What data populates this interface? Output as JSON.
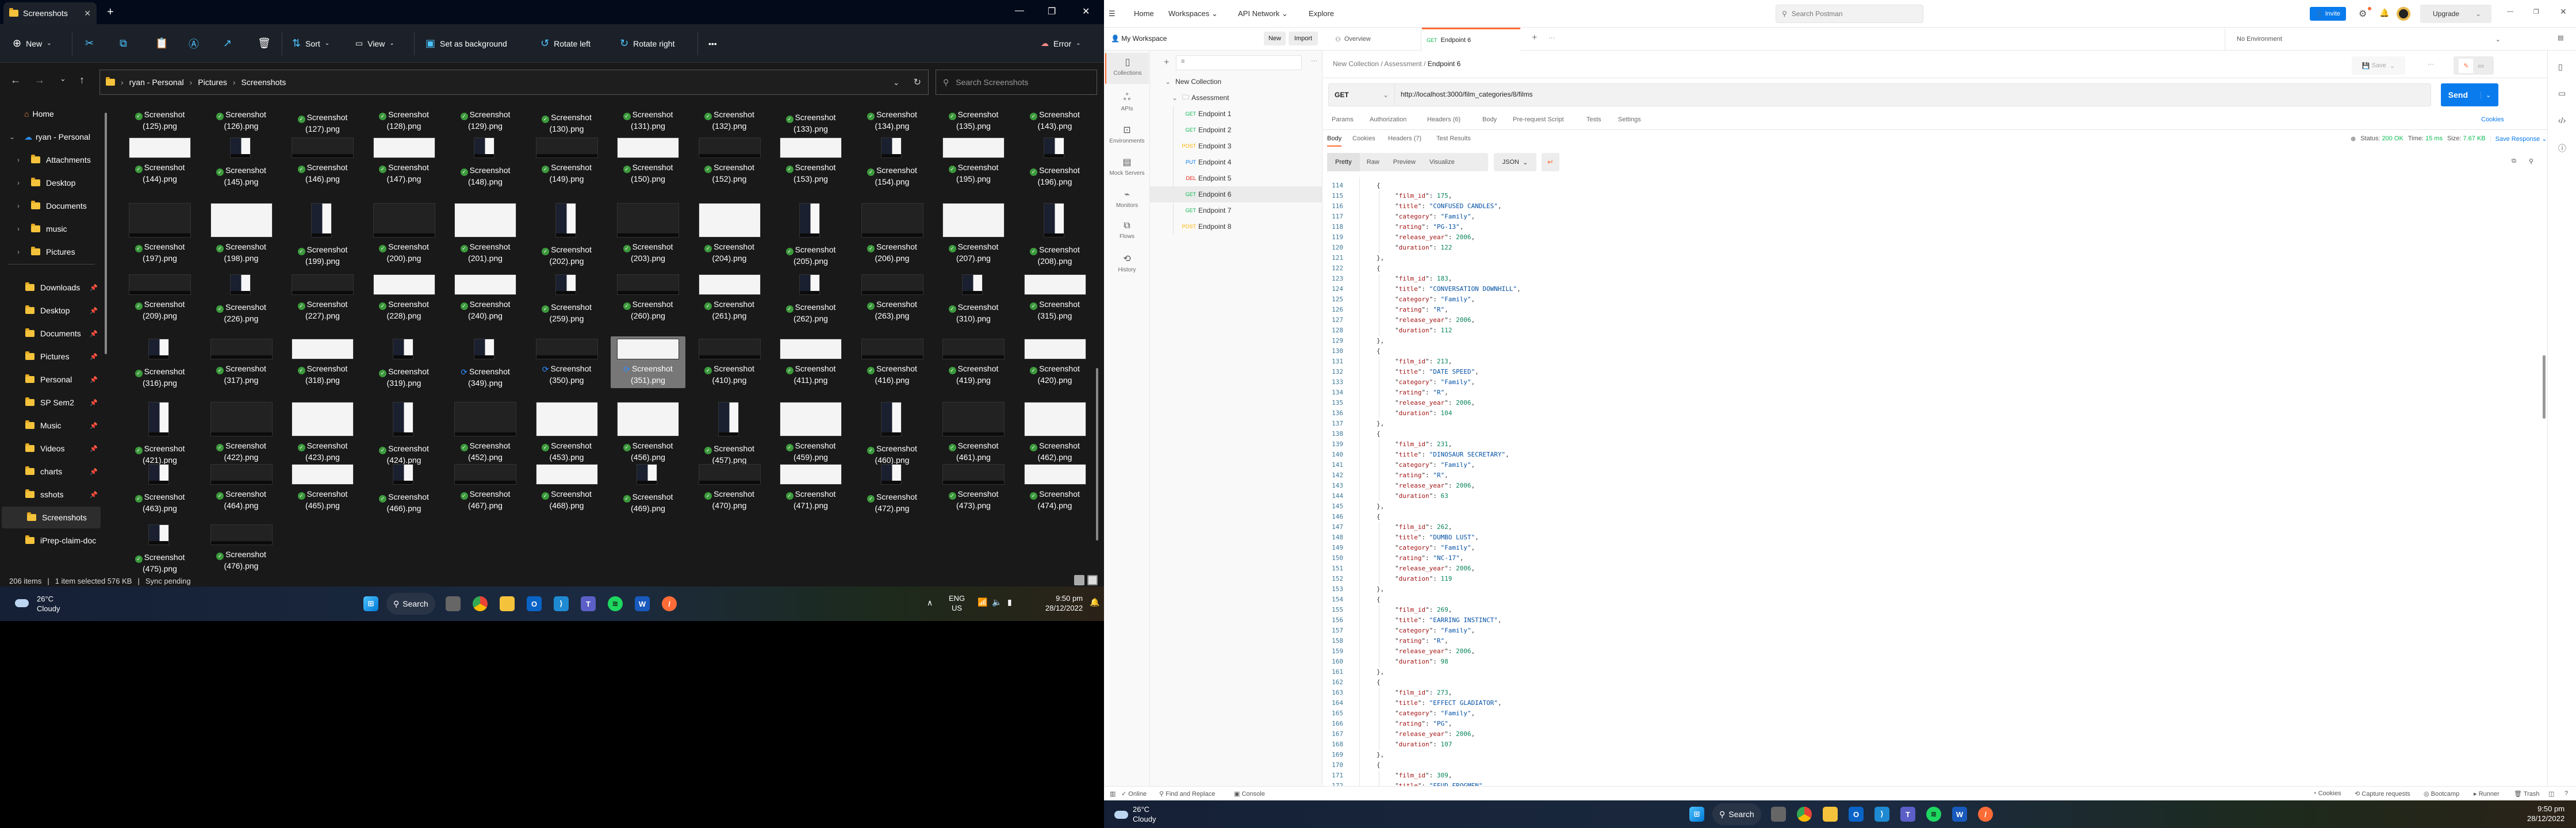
{
  "explorer": {
    "tab_title": "Screenshots",
    "new_tab": "+",
    "toolbar": {
      "new": "New",
      "sort": "Sort",
      "view": "View",
      "set_background": "Set as background",
      "rotate_left": "Rotate left",
      "rotate_right": "Rotate right",
      "more": "•••",
      "onedrive_status": "Error"
    },
    "breadcrumb": [
      "ryan - Personal",
      "Pictures",
      "Screenshots"
    ],
    "search_placeholder": "Search Screenshots",
    "sidebar": {
      "home": "Home",
      "onedrive": "ryan - Personal",
      "onedrive_children": [
        "Attachments",
        "Desktop",
        "Documents",
        "music",
        "Pictures"
      ],
      "quick_access": [
        "Downloads",
        "Desktop",
        "Documents",
        "Pictures",
        "Personal",
        "SP Sem2",
        "Music",
        "Videos",
        "charts",
        "sshots",
        "Screenshots",
        "iPrep-claim-doc"
      ]
    },
    "files": {
      "label_prefix": "Screenshot",
      "rows": [
        [
          "125",
          "126",
          "127",
          "128",
          "129",
          "130",
          "131",
          "132",
          "133",
          "134",
          "135",
          "143"
        ],
        [
          "144",
          "145",
          "146",
          "147",
          "148",
          "149",
          "150",
          "152",
          "153",
          "154",
          "195",
          "196"
        ],
        [
          "197",
          "198",
          "199",
          "200",
          "201",
          "202",
          "203",
          "204",
          "205",
          "206",
          "207",
          "208"
        ],
        [
          "209",
          "226",
          "227",
          "228",
          "240",
          "259",
          "260",
          "261",
          "262",
          "263",
          "310",
          "315"
        ],
        [
          "316",
          "317",
          "318",
          "319",
          "349",
          "350",
          "351",
          "410",
          "411",
          "416",
          "419",
          "420"
        ],
        [
          "421",
          "422",
          "423",
          "424",
          "452",
          "453",
          "456",
          "457",
          "459",
          "460",
          "461",
          "462"
        ],
        [
          "463",
          "464",
          "465",
          "466",
          "467",
          "468",
          "469",
          "470",
          "471",
          "472",
          "473",
          "474"
        ],
        [
          "475",
          "476"
        ]
      ],
      "pending_sync": [
        "349",
        "350",
        "351"
      ],
      "selected": "351"
    },
    "status": {
      "items": "206 items",
      "selected": "1 item selected  576 KB",
      "sync": "Sync pending"
    }
  },
  "taskbar": {
    "weather_temp": "26°C",
    "weather_desc": "Cloudy",
    "search": "Search",
    "lang": "ENG",
    "region": "US",
    "time": "9:50 pm",
    "date": "28/12/2022"
  },
  "postman": {
    "nav": [
      "Home",
      "Workspaces",
      "API Network",
      "Explore"
    ],
    "search_placeholder": "Search Postman",
    "invite": "Invite",
    "upgrade": "Upgrade",
    "workspace": "My Workspace",
    "new": "New",
    "import": "Import",
    "tabs": [
      {
        "label": "Overview"
      },
      {
        "method": "GET",
        "label": "Endpoint 6"
      }
    ],
    "environment": "No Environment",
    "rail": [
      "Collections",
      "APIs",
      "Environments",
      "Mock Servers",
      "Monitors",
      "Flows",
      "History"
    ],
    "collection": "New Collection",
    "folder": "Assessment",
    "endpoints": [
      {
        "method": "GET",
        "name": "Endpoint 1"
      },
      {
        "method": "GET",
        "name": "Endpoint 2"
      },
      {
        "method": "POST",
        "name": "Endpoint 3"
      },
      {
        "method": "PUT",
        "name": "Endpoint 4"
      },
      {
        "method": "DEL",
        "name": "Endpoint 5"
      },
      {
        "method": "GET",
        "name": "Endpoint 6"
      },
      {
        "method": "GET",
        "name": "Endpoint 7"
      },
      {
        "method": "POST",
        "name": "Endpoint 8"
      }
    ],
    "method_colors": {
      "GET": "#0cbb52",
      "POST": "#ffb400",
      "PUT": "#097bed",
      "DEL": "#eb2013"
    },
    "breadcrumb": [
      "New Collection",
      "Assessment",
      "Endpoint 6"
    ],
    "save": "Save",
    "request": {
      "method": "GET",
      "url": "http://localhost:3000/film_categories/8/films",
      "send": "Send"
    },
    "request_tabs": [
      "Params",
      "Authorization",
      "Headers (6)",
      "Body",
      "Pre-request Script",
      "Tests",
      "Settings"
    ],
    "cookies_link": "Cookies",
    "response_tabs": [
      "Body",
      "Cookies",
      "Headers (7)",
      "Test Results"
    ],
    "response_status": {
      "status": "Status: 200 OK",
      "time": "Time: 15 ms",
      "size": "Size: 7.67 KB",
      "save": "Save Response"
    },
    "view_modes": [
      "Pretty",
      "Raw",
      "Preview",
      "Visualize"
    ],
    "format": "JSON",
    "code_lines": [
      {
        "n": 114,
        "b": "{"
      },
      {
        "n": 115,
        "k": "film_id",
        "v": "175",
        "t": "num"
      },
      {
        "n": 116,
        "k": "title",
        "v": "CONFUSED CANDLES",
        "t": "str"
      },
      {
        "n": 117,
        "k": "category",
        "v": "Family",
        "t": "str"
      },
      {
        "n": 118,
        "k": "rating",
        "v": "PG-13",
        "t": "str"
      },
      {
        "n": 119,
        "k": "release_year",
        "v": "2006",
        "t": "num"
      },
      {
        "n": 120,
        "k": "duration",
        "v": "122",
        "t": "num",
        "last": true
      },
      {
        "n": 121,
        "b": "},"
      },
      {
        "n": 122,
        "b": "{"
      },
      {
        "n": 123,
        "k": "film_id",
        "v": "183",
        "t": "num"
      },
      {
        "n": 124,
        "k": "title",
        "v": "CONVERSATION DOWNHILL",
        "t": "str"
      },
      {
        "n": 125,
        "k": "category",
        "v": "Family",
        "t": "str"
      },
      {
        "n": 126,
        "k": "rating",
        "v": "R",
        "t": "str"
      },
      {
        "n": 127,
        "k": "release_year",
        "v": "2006",
        "t": "num"
      },
      {
        "n": 128,
        "k": "duration",
        "v": "112",
        "t": "num",
        "last": true
      },
      {
        "n": 129,
        "b": "},"
      },
      {
        "n": 130,
        "b": "{"
      },
      {
        "n": 131,
        "k": "film_id",
        "v": "213",
        "t": "num"
      },
      {
        "n": 132,
        "k": "title",
        "v": "DATE SPEED",
        "t": "str"
      },
      {
        "n": 133,
        "k": "category",
        "v": "Family",
        "t": "str"
      },
      {
        "n": 134,
        "k": "rating",
        "v": "R",
        "t": "str"
      },
      {
        "n": 135,
        "k": "release_year",
        "v": "2006",
        "t": "num"
      },
      {
        "n": 136,
        "k": "duration",
        "v": "104",
        "t": "num",
        "last": true
      },
      {
        "n": 137,
        "b": "},"
      },
      {
        "n": 138,
        "b": "{"
      },
      {
        "n": 139,
        "k": "film_id",
        "v": "231",
        "t": "num"
      },
      {
        "n": 140,
        "k": "title",
        "v": "DINOSAUR SECRETARY",
        "t": "str"
      },
      {
        "n": 141,
        "k": "category",
        "v": "Family",
        "t": "str"
      },
      {
        "n": 142,
        "k": "rating",
        "v": "R",
        "t": "str"
      },
      {
        "n": 143,
        "k": "release_year",
        "v": "2006",
        "t": "num"
      },
      {
        "n": 144,
        "k": "duration",
        "v": "63",
        "t": "num",
        "last": true
      },
      {
        "n": 145,
        "b": "},"
      },
      {
        "n": 146,
        "b": "{"
      },
      {
        "n": 147,
        "k": "film_id",
        "v": "262",
        "t": "num"
      },
      {
        "n": 148,
        "k": "title",
        "v": "DUMBO LUST",
        "t": "str"
      },
      {
        "n": 149,
        "k": "category",
        "v": "Family",
        "t": "str"
      },
      {
        "n": 150,
        "k": "rating",
        "v": "NC-17",
        "t": "str"
      },
      {
        "n": 151,
        "k": "release_year",
        "v": "2006",
        "t": "num"
      },
      {
        "n": 152,
        "k": "duration",
        "v": "119",
        "t": "num",
        "last": true
      },
      {
        "n": 153,
        "b": "},"
      },
      {
        "n": 154,
        "b": "{"
      },
      {
        "n": 155,
        "k": "film_id",
        "v": "269",
        "t": "num"
      },
      {
        "n": 156,
        "k": "title",
        "v": "EARRING INSTINCT",
        "t": "str"
      },
      {
        "n": 157,
        "k": "category",
        "v": "Family",
        "t": "str"
      },
      {
        "n": 158,
        "k": "rating",
        "v": "R",
        "t": "str"
      },
      {
        "n": 159,
        "k": "release_year",
        "v": "2006",
        "t": "num"
      },
      {
        "n": 160,
        "k": "duration",
        "v": "98",
        "t": "num",
        "last": true
      },
      {
        "n": 161,
        "b": "},"
      },
      {
        "n": 162,
        "b": "{"
      },
      {
        "n": 163,
        "k": "film_id",
        "v": "273",
        "t": "num"
      },
      {
        "n": 164,
        "k": "title",
        "v": "EFFECT GLADIATOR",
        "t": "str"
      },
      {
        "n": 165,
        "k": "category",
        "v": "Family",
        "t": "str"
      },
      {
        "n": 166,
        "k": "rating",
        "v": "PG",
        "t": "str"
      },
      {
        "n": 167,
        "k": "release_year",
        "v": "2006",
        "t": "num"
      },
      {
        "n": 168,
        "k": "duration",
        "v": "107",
        "t": "num",
        "last": true
      },
      {
        "n": 169,
        "b": "},"
      },
      {
        "n": 170,
        "b": "{"
      },
      {
        "n": 171,
        "k": "film_id",
        "v": "309",
        "t": "num"
      },
      {
        "n": 172,
        "k": "title",
        "v": "FEUD FROGMEN",
        "t": "str"
      }
    ],
    "statusbar_left": [
      "Online",
      "Find and Replace",
      "Console"
    ],
    "statusbar_right": [
      "Cookies",
      "Capture requests",
      "Bootcamp",
      "Runner",
      "Trash"
    ],
    "accent": "#ff6c37",
    "send_color": "#097bed"
  }
}
